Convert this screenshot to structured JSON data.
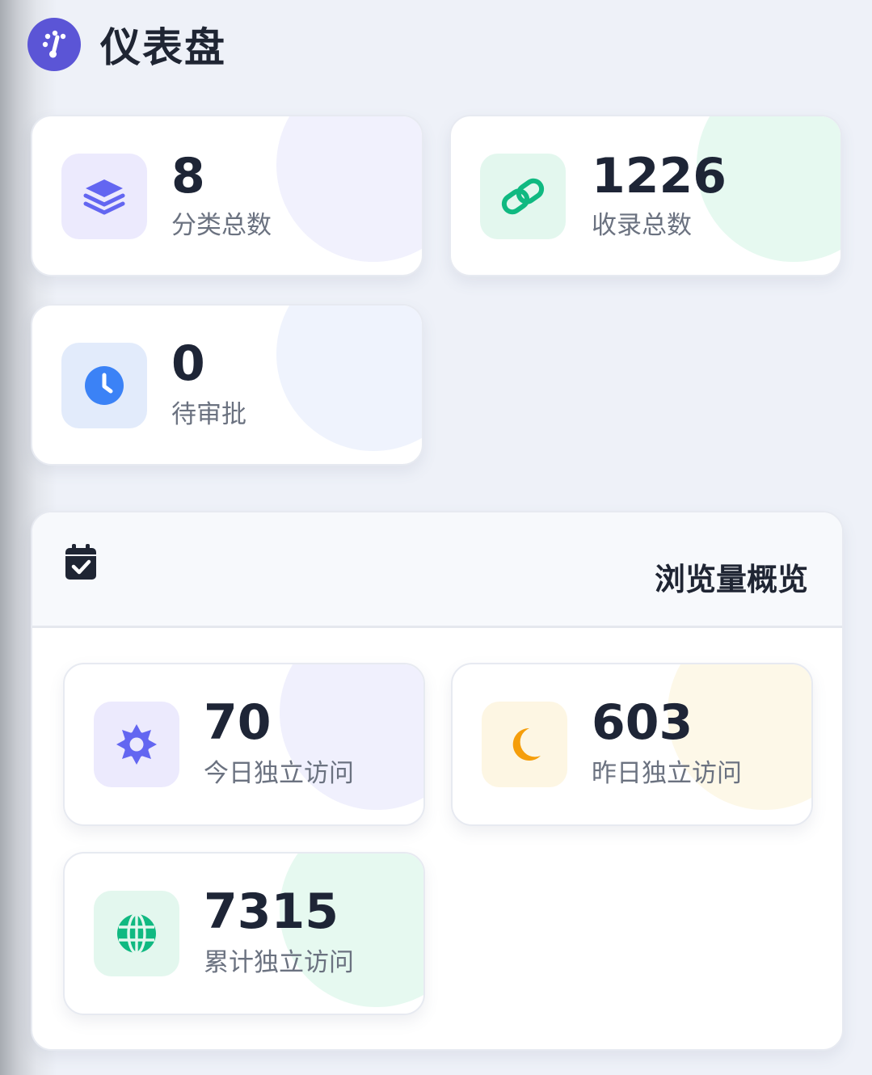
{
  "header": {
    "title": "仪表盘",
    "icon": "dashboard-gauge-icon"
  },
  "stats": [
    {
      "value": "8",
      "label": "分类总数",
      "icon": "layers-icon"
    },
    {
      "value": "1226",
      "label": "收录总数",
      "icon": "link-icon"
    },
    {
      "value": "0",
      "label": "待审批",
      "icon": "clock-icon"
    }
  ],
  "traffic": {
    "title": "浏览量概览",
    "icon": "calendar-check-icon",
    "cards": [
      {
        "value": "70",
        "label": "今日独立访问",
        "icon": "sun-icon"
      },
      {
        "value": "603",
        "label": "昨日独立访问",
        "icon": "moon-icon"
      },
      {
        "value": "7315",
        "label": "累计独立访问",
        "icon": "globe-icon"
      }
    ]
  },
  "colors": {
    "accent": "#5b55d6",
    "indigo": "#6366f1",
    "green": "#10b981",
    "blue": "#3b82f6",
    "amber": "#f59e0b"
  }
}
